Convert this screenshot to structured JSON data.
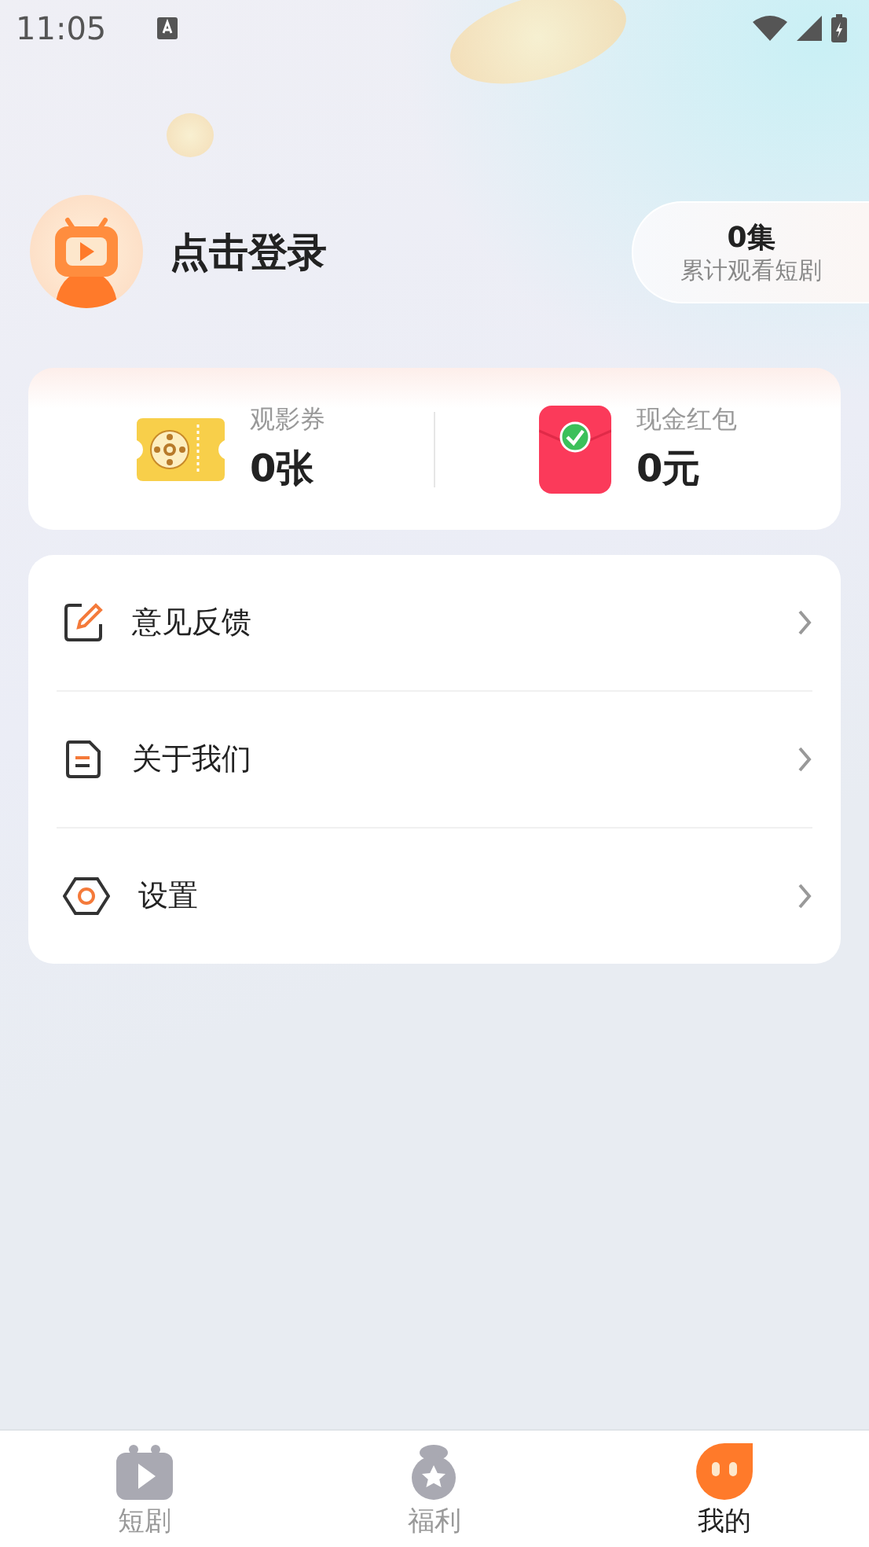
{
  "status_bar": {
    "time": "11:05"
  },
  "profile": {
    "login_label": "点击登录",
    "watch_count": "0集",
    "watch_caption": "累计观看短剧"
  },
  "wallet": [
    {
      "kind": "ticket",
      "label": "观影券",
      "value": "0张"
    },
    {
      "kind": "red-packet",
      "label": "现金红包",
      "value": "0元"
    }
  ],
  "menu": [
    {
      "kind": "feedback",
      "label": "意见反馈"
    },
    {
      "kind": "about",
      "label": "关于我们"
    },
    {
      "kind": "settings",
      "label": "设置"
    }
  ],
  "tabs": [
    {
      "kind": "drama",
      "label": "短剧",
      "selected": false
    },
    {
      "kind": "welfare",
      "label": "福利",
      "selected": false
    },
    {
      "kind": "mine",
      "label": "我的",
      "selected": true
    }
  ]
}
